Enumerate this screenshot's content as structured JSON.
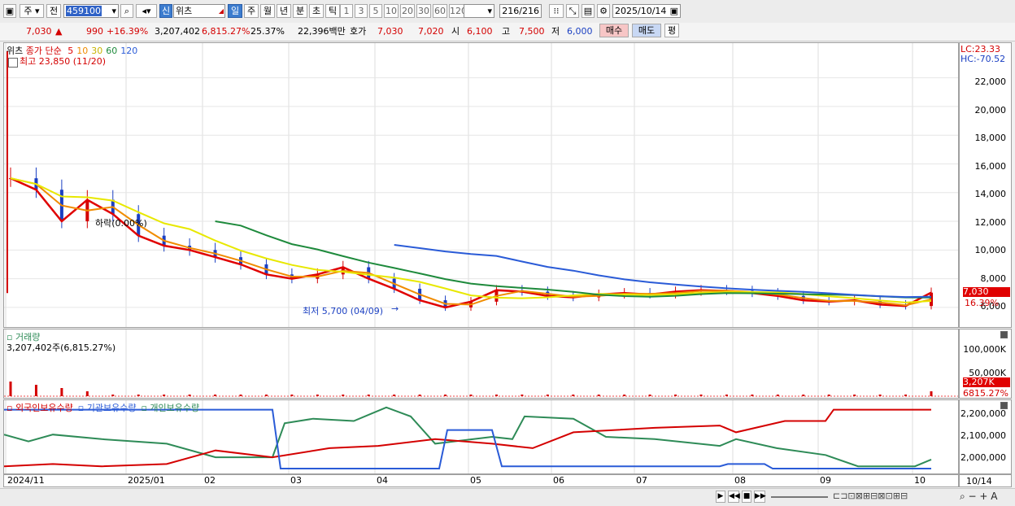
{
  "toolbar": {
    "market": "주",
    "prev": "전",
    "code": "459100",
    "badge": "신",
    "name": "위츠",
    "periods": [
      "일",
      "주",
      "월",
      "년",
      "분",
      "초",
      "틱"
    ],
    "active_period": "일",
    "minutes": [
      "1",
      "3",
      "5",
      "10",
      "20",
      "30",
      "60",
      "120"
    ],
    "count": "216/216",
    "date": "2025/10/14"
  },
  "quote": {
    "price": "7,030",
    "change": "990",
    "change_pct": "+16.39%",
    "volume": "3,207,402",
    "vol_pct": "6,815.27%",
    "turnover": "25.37%",
    "amount": "22,396백만",
    "bid_label": "호가",
    "ask": "7,030",
    "bid": "7,020",
    "open_label": "시",
    "open": "6,100",
    "high_label": "고",
    "high": "7,500",
    "low_label": "저",
    "low": "6,000",
    "buy": "매수",
    "sell": "매도",
    "eval": "평"
  },
  "price_pane": {
    "legend_name": "위츠",
    "legend_ma": "종가 단순",
    "ma": [
      {
        "period": "5",
        "color": "#e00000"
      },
      {
        "period": "10",
        "color": "#f08c00"
      },
      {
        "period": "30",
        "color": "#e8e800"
      },
      {
        "period": "60",
        "color": "#1e8a3c"
      },
      {
        "period": "120",
        "color": "#2a5bd7"
      }
    ],
    "high_note": "최고 23,850 (11/20)",
    "low_note": "최저 5,700 (04/09)",
    "fall_note": "하락(0.00%)",
    "lc": "LC:23.33",
    "hc": "HC:-70.52",
    "yticks": [
      "22,000",
      "20,000",
      "18,000",
      "16,000",
      "14,000",
      "12,000",
      "10,000",
      "8,000",
      "6,000"
    ],
    "current_tag": "7,030",
    "current_pct": "16.39%"
  },
  "volume_pane": {
    "title": "거래량",
    "value": "3,207,402주(6,815.27%)",
    "yticks": [
      "100,000K",
      "50,000K"
    ],
    "current_tag": "3,207K",
    "current_pct": "6815.27%"
  },
  "holdings_pane": {
    "legend": [
      {
        "label": "외국인보유수량",
        "color": "#d40000"
      },
      {
        "label": "기관보유수량",
        "color": "#2a5bd7"
      },
      {
        "label": "개인보유수량",
        "color": "#2e8b57"
      }
    ],
    "yticks": [
      "2,200,000",
      "2,100,000",
      "2,000,000"
    ]
  },
  "xaxis": {
    "labels": [
      "2024/11",
      "2025/01",
      "02",
      "03",
      "04",
      "05",
      "06",
      "07",
      "08",
      "09",
      "10"
    ],
    "end": "10/14"
  },
  "chart_data": {
    "type": "line",
    "title": "",
    "y_range_price": [
      5700,
      23850
    ],
    "high": {
      "value": 23850,
      "date": "11/20"
    },
    "low": {
      "value": 5700,
      "date": "04/09"
    },
    "last_close": 7030,
    "ma_periods": [
      5,
      10,
      30,
      60,
      120
    ],
    "close_series_approx": [
      15000,
      14200,
      12000,
      13500,
      12500,
      11000,
      10300,
      10000,
      9500,
      9000,
      8300,
      8000,
      8300,
      8800,
      8000,
      7300,
      6500,
      6000,
      6400,
      7200,
      7100,
      6800,
      6700,
      6900,
      7000,
      6900,
      7100,
      7200,
      7150,
      7000,
      6800,
      6500,
      6400,
      6500,
      6200,
      6100,
      7030
    ],
    "volume_last": 3207402,
    "holdings_range": [
      1950000,
      2230000
    ]
  }
}
